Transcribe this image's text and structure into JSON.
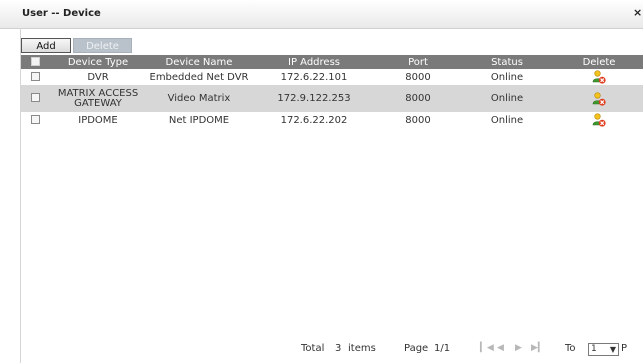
{
  "window": {
    "title": "User -- Device",
    "close_label": "×"
  },
  "toolbar": {
    "add_label": "Add",
    "delete_label": "Delete"
  },
  "table": {
    "headers": [
      "Device Type",
      "Device Name",
      "IP Address",
      "Port",
      "Status",
      "Delete"
    ],
    "rows": [
      {
        "device_type": "DVR",
        "device_name": "Embedded Net DVR",
        "ip": "172.6.22.101",
        "port": "8000",
        "status": "Online"
      },
      {
        "device_type": "MATRIX ACCESS GATEWAY",
        "device_name": "Video Matrix",
        "ip": "172.9.122.253",
        "port": "8000",
        "status": "Online"
      },
      {
        "device_type": "IPDOME",
        "device_name": "Net IPDOME",
        "ip": "172.6.22.202",
        "port": "8000",
        "status": "Online"
      }
    ]
  },
  "footer": {
    "total_label": "Total",
    "total_count": "3",
    "items_label": "items",
    "page_label": "Page",
    "page_value": "1/1",
    "to_label": "To",
    "to_value": "1",
    "page_suffix": "P"
  },
  "icons": {
    "delete": "user-delete-icon",
    "first": "first-page-icon",
    "prev": "prev-page-icon",
    "next": "next-page-icon",
    "last": "last-page-icon"
  },
  "colors": {
    "header_bg": "#7a7a7a",
    "alt_row_bg": "#d7d7d7",
    "disabled_button_bg": "#b9c2ca"
  }
}
